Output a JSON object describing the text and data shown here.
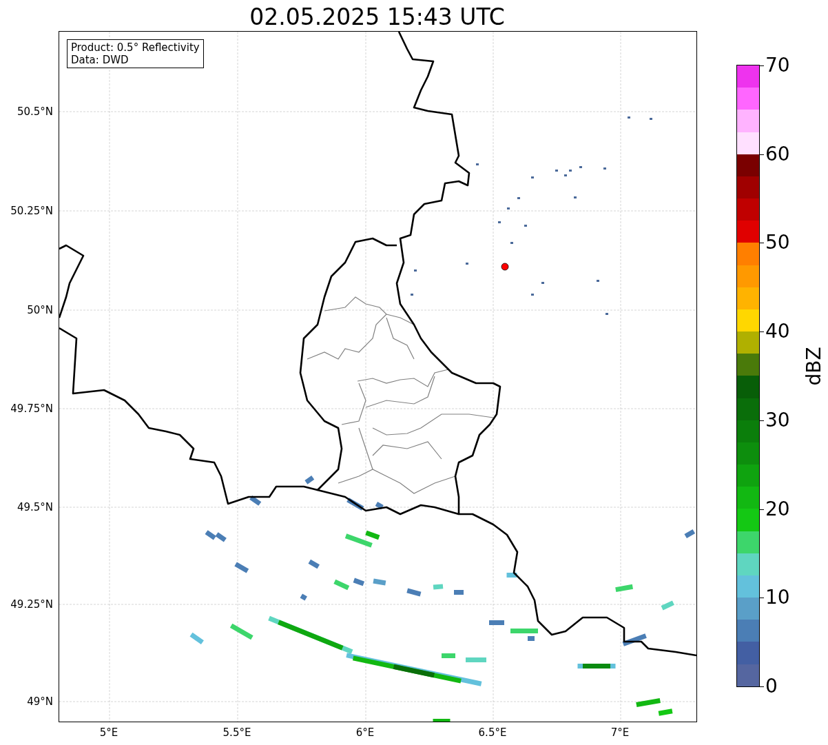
{
  "title": "02.05.2025 15:43 UTC",
  "info_box": {
    "lines": [
      "Product: 0.5° Reflectivity",
      "Data: DWD"
    ]
  },
  "y_axis": {
    "labels": [
      "50.5°N",
      "50.25°N",
      "50°N",
      "49.75°N",
      "49.5°N",
      "49.25°N",
      "49°N"
    ]
  },
  "x_axis": {
    "labels": [
      "5°E",
      "5.5°E",
      "6°E",
      "6.5°E",
      "7°E"
    ]
  },
  "colorbar": {
    "label": "dBZ",
    "ticks": [
      "70",
      "60",
      "50",
      "40",
      "30",
      "20",
      "10",
      "0"
    ],
    "bands": [
      {
        "color": "#ee33ee"
      },
      {
        "color": "#ff66ff"
      },
      {
        "color": "#ffb3ff"
      },
      {
        "color": "#ffe0ff"
      },
      {
        "color": "#7a0000"
      },
      {
        "color": "#a00000"
      },
      {
        "color": "#c00000"
      },
      {
        "color": "#e00000"
      },
      {
        "color": "#ff7f00"
      },
      {
        "color": "#ff9900"
      },
      {
        "color": "#ffb300"
      },
      {
        "color": "#ffd700"
      },
      {
        "color": "#b0b000"
      },
      {
        "color": "#4a7a0a"
      },
      {
        "color": "#085e08"
      },
      {
        "color": "#0a6e0a"
      },
      {
        "color": "#0b7e0b"
      },
      {
        "color": "#0d8e0d"
      },
      {
        "color": "#0fa30f"
      },
      {
        "color": "#12b812"
      },
      {
        "color": "#14c814"
      },
      {
        "color": "#3dd66b"
      },
      {
        "color": "#5fd6c0"
      },
      {
        "color": "#63c1dc"
      },
      {
        "color": "#5a9fc8"
      },
      {
        "color": "#4b7eb5"
      },
      {
        "color": "#435fa3"
      },
      {
        "color": "#5566a0"
      }
    ]
  }
}
